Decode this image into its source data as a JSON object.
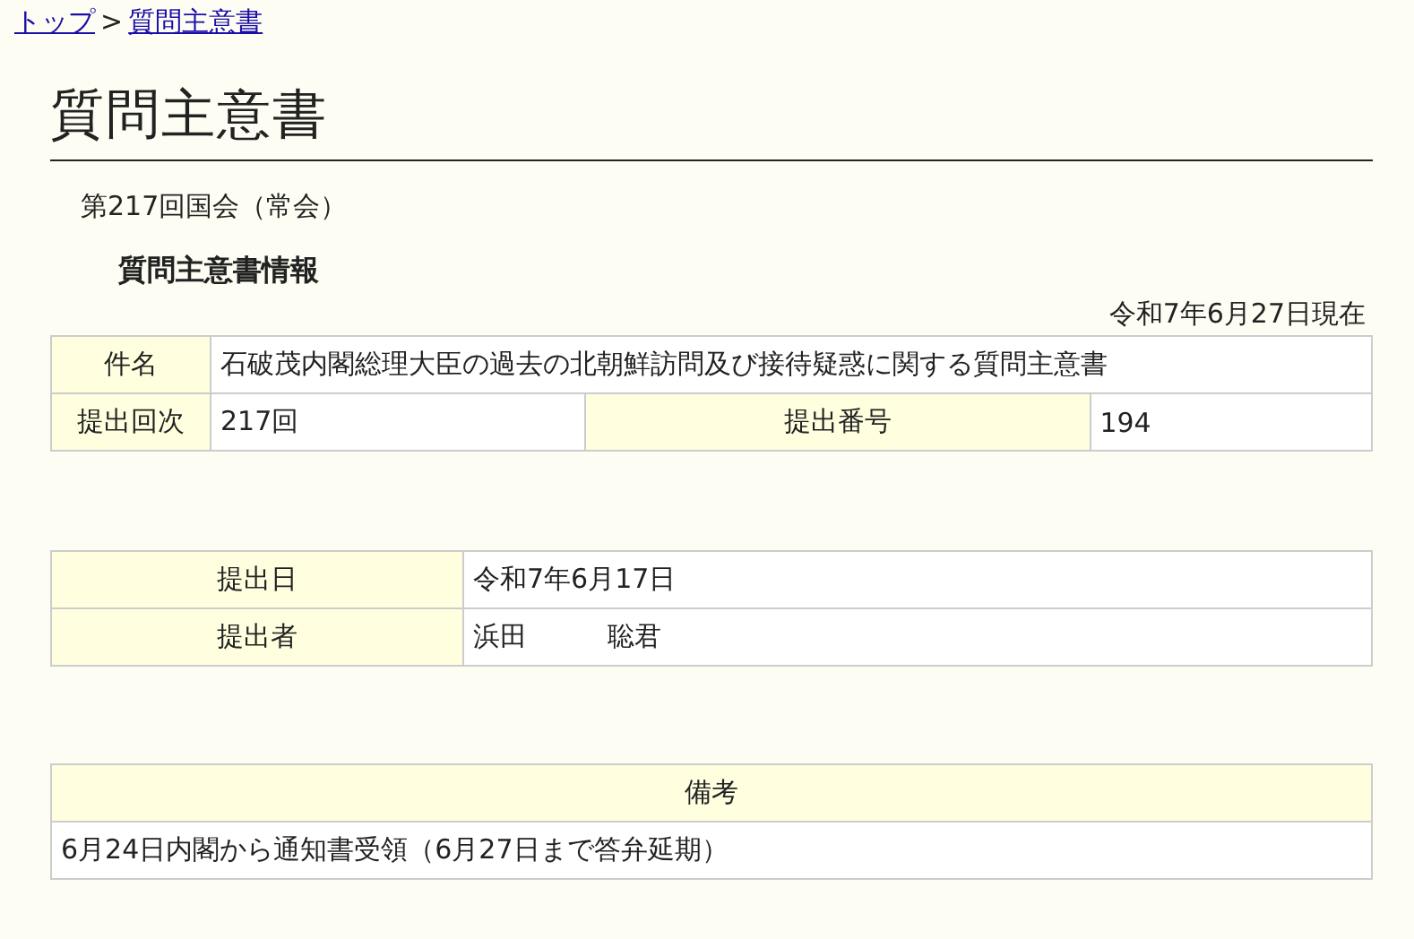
{
  "breadcrumb": {
    "items": [
      {
        "label": "トップ",
        "kind": "link"
      },
      {
        "label": ">",
        "kind": "separator"
      },
      {
        "label": "質問主意書",
        "kind": "link"
      }
    ]
  },
  "title": "質問主意書",
  "session": "第217回国会（常会）",
  "section_title": "質問主意書情報",
  "as_of": "令和7年6月27日現在",
  "info_table": {
    "rows": [
      {
        "cells": [
          {
            "text": "件名",
            "kind": "label"
          },
          {
            "text": "石破茂内閣総理大臣の過去の北朝鮮訪問及び接待疑惑に関する質問主意書",
            "kind": "value",
            "colspan": 3
          }
        ]
      },
      {
        "cells": [
          {
            "text": "提出回次",
            "kind": "label"
          },
          {
            "text": "217回",
            "kind": "value"
          },
          {
            "text": "提出番号",
            "kind": "label"
          },
          {
            "text": "194",
            "kind": "value"
          }
        ]
      }
    ]
  },
  "submit_table": {
    "rows": [
      {
        "label": "提出日",
        "value": "令和7年6月17日"
      },
      {
        "label": "提出者",
        "value": "浜田　　　聡君"
      }
    ]
  },
  "notes": {
    "header": "備考",
    "text": "6月24日内閣から通知書受領（6月27日まで答弁延期）"
  }
}
